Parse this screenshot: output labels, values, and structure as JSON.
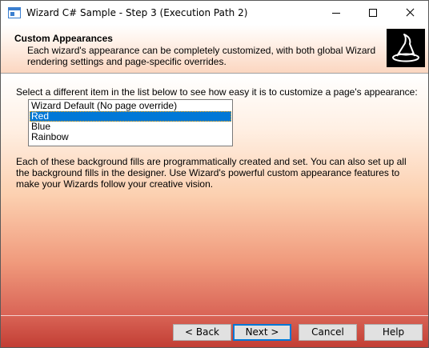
{
  "window": {
    "title": "Wizard C# Sample - Step 3 (Execution Path 2)",
    "controls": [
      "minimize-icon",
      "maximize-icon",
      "close-icon"
    ]
  },
  "header": {
    "title": "Custom Appearances",
    "description": "Each wizard's appearance can be completely customized, with both global Wizard rendering settings and page-specific overrides.",
    "icon": "wizard-hat-icon"
  },
  "body": {
    "prompt": "Select a different item in the list below to see how easy it is to customize a page's appearance:",
    "list": {
      "items": [
        "Wizard Default (No page override)",
        "Red",
        "Blue",
        "Rainbow"
      ],
      "selected": "Red"
    },
    "note": "Each of these background fills are programmatically created and set.  You can also set up all the background fills in the designer.  Use Wizard's powerful custom appearance features to make your Wizards follow your creative vision."
  },
  "footer": {
    "back_label": "< Back",
    "next_label": "Next >",
    "cancel_label": "Cancel",
    "help_label": "Help"
  },
  "colors": {
    "selection": "#0078d7",
    "footer_red": "#c23e34",
    "header_peach": "#fbd6c0"
  }
}
